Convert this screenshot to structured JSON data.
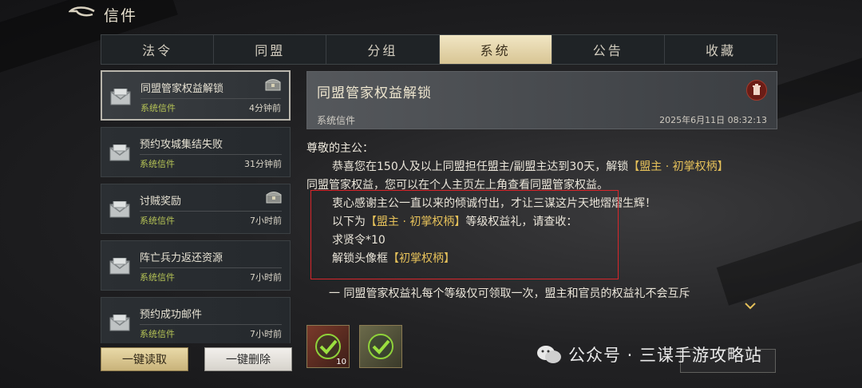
{
  "header": {
    "title": "信件"
  },
  "tabs": [
    {
      "label": "法令"
    },
    {
      "label": "同盟"
    },
    {
      "label": "分组"
    },
    {
      "label": "系统"
    },
    {
      "label": "公告"
    },
    {
      "label": "收藏"
    }
  ],
  "active_tab": "系统",
  "mail_list": [
    {
      "title": "同盟管家权益解锁",
      "category": "系统信件",
      "time": "4分钟前",
      "has_attachment": true,
      "selected": true
    },
    {
      "title": "预约攻城集结失败",
      "category": "系统信件",
      "time": "31分钟前",
      "has_attachment": false
    },
    {
      "title": "讨贼奖励",
      "category": "系统信件",
      "time": "7小时前",
      "has_attachment": true
    },
    {
      "title": "阵亡兵力返还资源",
      "category": "系统信件",
      "time": "7小时前",
      "has_attachment": false
    },
    {
      "title": "预约成功邮件",
      "category": "系统信件",
      "time": "7小时前",
      "has_attachment": false
    }
  ],
  "buttons": {
    "read_all": "一键读取",
    "delete_all": "一键删除"
  },
  "detail": {
    "title": "同盟管家权益解锁",
    "category": "系统信件",
    "timestamp": "2025年6月11日 08:32:13",
    "greeting": "尊敬的主公：",
    "line1_pre": "恭喜您在150人及以上同盟担任盟主/副盟主达到30天，解锁",
    "line1_hl": "【盟主 · 初掌权柄】",
    "line2": "同盟管家权益，您可以在个人主页左上角查看同盟管家权益。",
    "line3": "衷心感谢主公一直以来的倾诚付出，才让三谋这片天地熠熠生辉！",
    "line4_pre": "以下为",
    "line4_hl": "【盟主 · 初掌权柄】",
    "line4_post": "等级权益礼，请查收：",
    "line5": "求贤令*10",
    "line6_pre": "解锁头像框",
    "line6_hl": "【初掌权柄】",
    "note": "一 同盟管家权益礼每个等级仅可领取一次，盟主和官员的权益礼不会互斥"
  },
  "rewards": [
    {
      "icon": "scroll-reward-icon",
      "quantity": "10",
      "claimed": true
    },
    {
      "icon": "avatar-frame-reward-icon",
      "quantity": "",
      "claimed": true
    }
  ],
  "watermark": "公众号 · 三谋手游攻略站",
  "colors": {
    "highlight": "#e6c15a",
    "category_green": "#b6c456",
    "annotation_red": "#d9262b",
    "active_tab": "#e3d3a5"
  }
}
